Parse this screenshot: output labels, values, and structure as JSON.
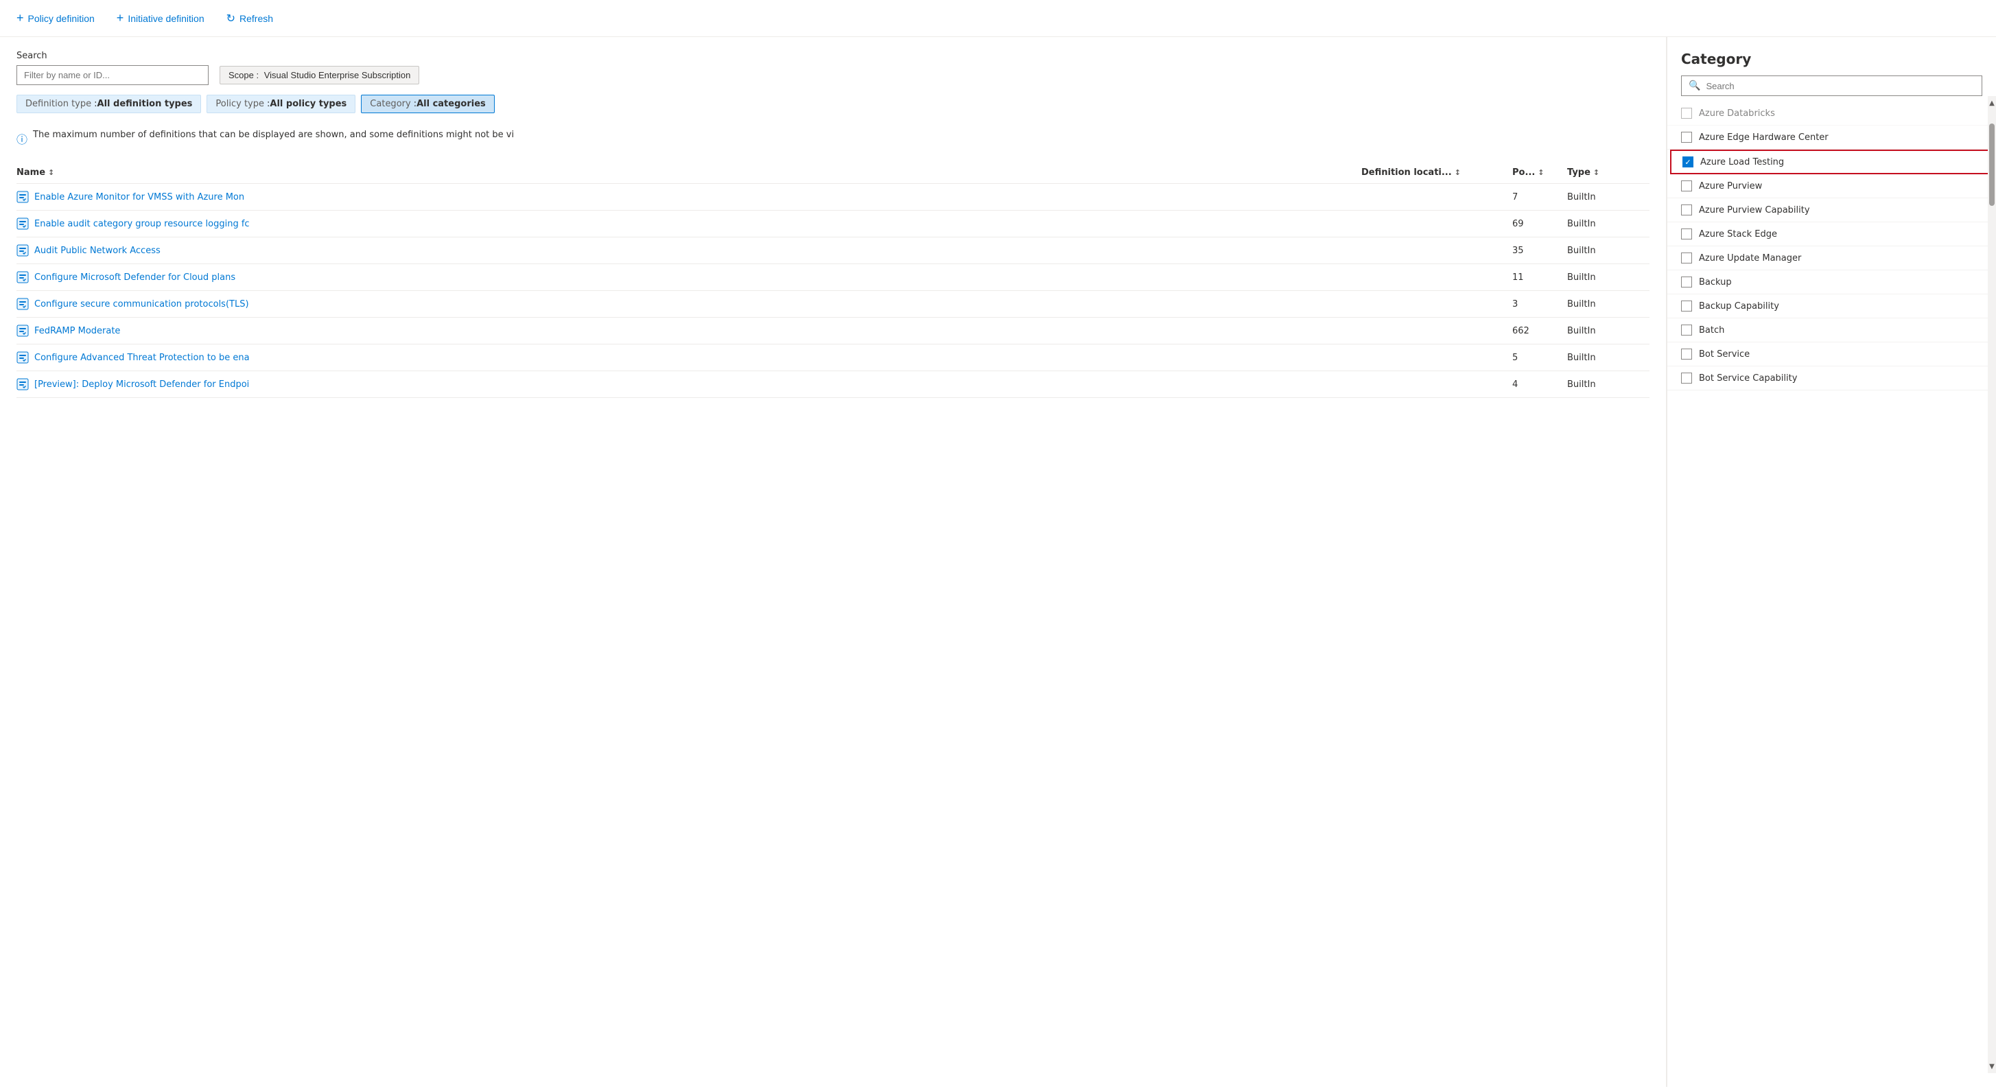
{
  "toolbar": {
    "policy_definition_label": "Policy definition",
    "initiative_definition_label": "Initiative definition",
    "refresh_label": "Refresh"
  },
  "search": {
    "label": "Search",
    "placeholder": "Filter by name or ID..."
  },
  "scope": {
    "label": "Scope",
    "value": "Visual Studio Enterprise Subscription"
  },
  "filters": {
    "definition_type_key": "Definition type",
    "definition_type_value": "All definition types",
    "policy_type_key": "Policy type",
    "policy_type_value": "All policy types",
    "category_key": "Category",
    "category_value": "All categories"
  },
  "info_message": "The maximum number of definitions that can be displayed are shown, and some definitions might not be vi",
  "table": {
    "columns": {
      "name": "Name",
      "definition_location": "Definition locati...",
      "policies": "Po...",
      "type": "Type"
    },
    "rows": [
      {
        "name": "Enable Azure Monitor for VMSS with Azure Mon",
        "location": "",
        "policies": "7",
        "type": "BuiltIn"
      },
      {
        "name": "Enable audit category group resource logging fc",
        "location": "",
        "policies": "69",
        "type": "BuiltIn"
      },
      {
        "name": "Audit Public Network Access",
        "location": "",
        "policies": "35",
        "type": "BuiltIn"
      },
      {
        "name": "Configure Microsoft Defender for Cloud plans",
        "location": "",
        "policies": "11",
        "type": "BuiltIn"
      },
      {
        "name": "Configure secure communication protocols(TLS)",
        "location": "",
        "policies": "3",
        "type": "BuiltIn"
      },
      {
        "name": "FedRAMP Moderate",
        "location": "",
        "policies": "662",
        "type": "BuiltIn"
      },
      {
        "name": "Configure Advanced Threat Protection to be ena",
        "location": "",
        "policies": "5",
        "type": "BuiltIn"
      },
      {
        "name": "[Preview]: Deploy Microsoft Defender for Endpoi",
        "location": "",
        "policies": "4",
        "type": "BuiltIn"
      }
    ]
  },
  "category_panel": {
    "title": "Category",
    "search_placeholder": "Search",
    "items": [
      {
        "label": "Azure Databricks",
        "checked": false,
        "truncated": true
      },
      {
        "label": "Azure Edge Hardware Center",
        "checked": false
      },
      {
        "label": "Azure Load Testing",
        "checked": true
      },
      {
        "label": "Azure Purview",
        "checked": false
      },
      {
        "label": "Azure Purview Capability",
        "checked": false
      },
      {
        "label": "Azure Stack Edge",
        "checked": false
      },
      {
        "label": "Azure Update Manager",
        "checked": false
      },
      {
        "label": "Backup",
        "checked": false
      },
      {
        "label": "Backup Capability",
        "checked": false
      },
      {
        "label": "Batch",
        "checked": false
      },
      {
        "label": "Bot Service",
        "checked": false
      },
      {
        "label": "Bot Service Capability",
        "checked": false
      }
    ]
  }
}
